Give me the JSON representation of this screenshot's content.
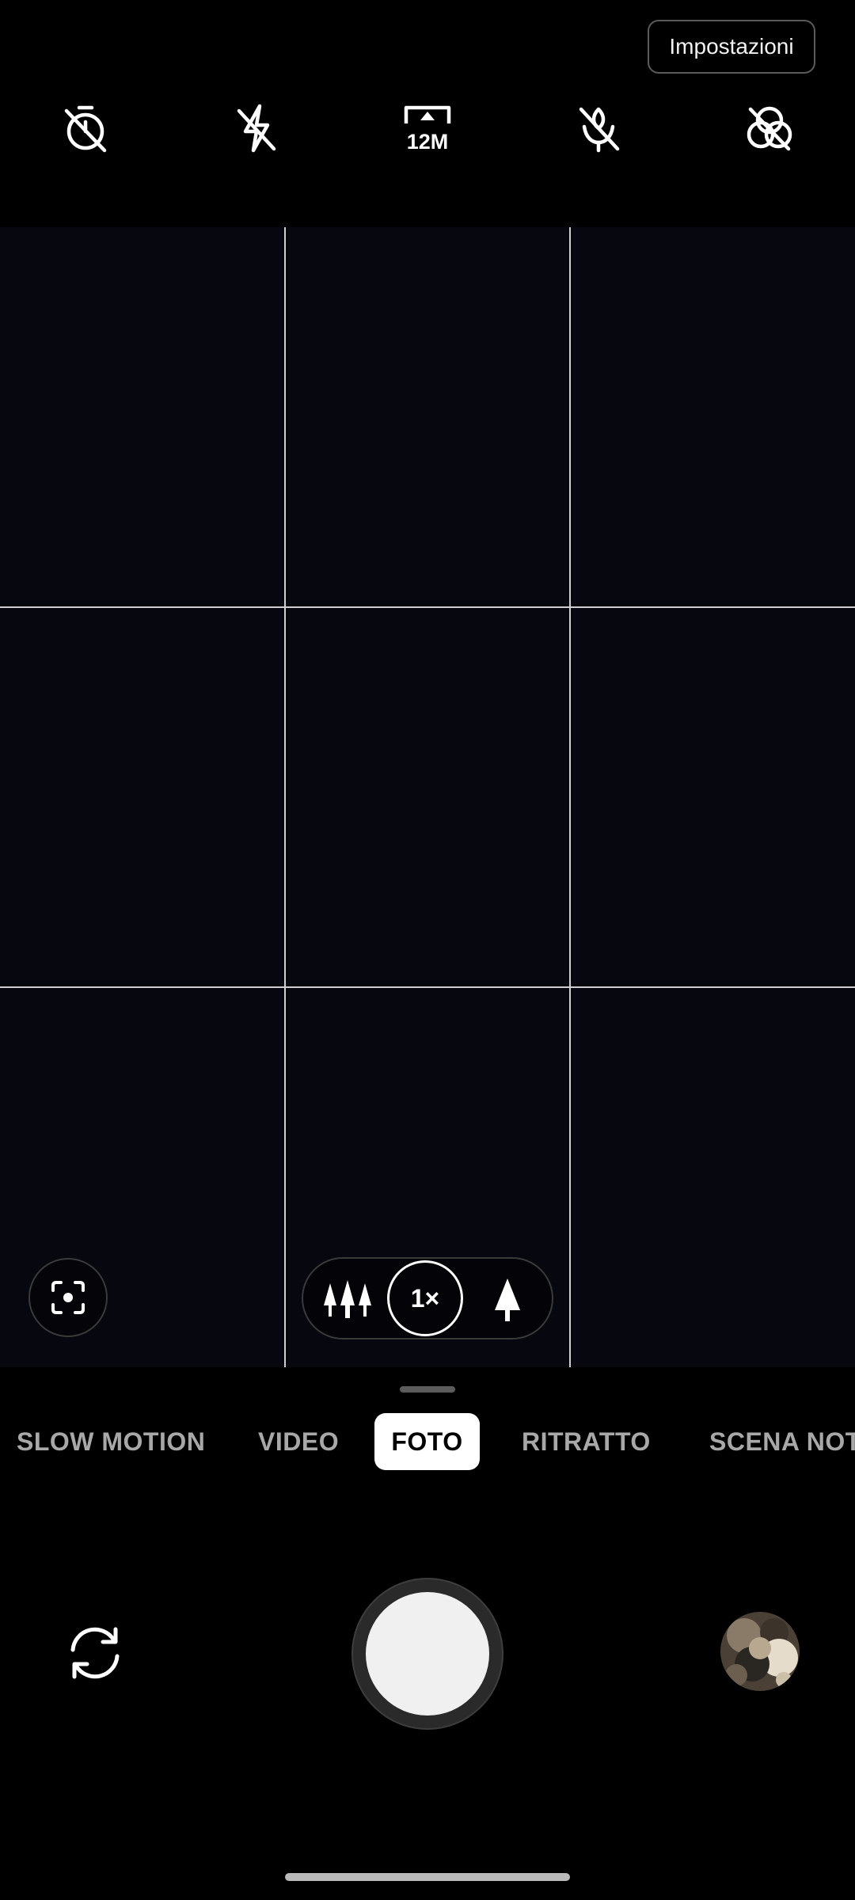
{
  "header": {
    "settings_label": "Impostazioni"
  },
  "top_controls": [
    {
      "icon": "timer-off-icon"
    },
    {
      "icon": "flash-off-icon"
    },
    {
      "icon": "resolution-icon",
      "label": "12M"
    },
    {
      "icon": "macro-off-icon"
    },
    {
      "icon": "filter-off-icon"
    }
  ],
  "zoom": {
    "current": "1×",
    "options": [
      "wide-angle",
      "1×",
      "telephoto"
    ]
  },
  "modes": [
    {
      "label": "SLOW MOTION"
    },
    {
      "label": "VIDEO"
    },
    {
      "label": "FOTO",
      "active": true
    },
    {
      "label": "RITRATTO"
    },
    {
      "label": "SCENA NOTTURNA"
    }
  ],
  "colors": {
    "background": "#000000",
    "viewfinder": "#07070f",
    "active_mode_bg": "#ffffff",
    "inactive_mode_text": "#a8a8a8"
  }
}
